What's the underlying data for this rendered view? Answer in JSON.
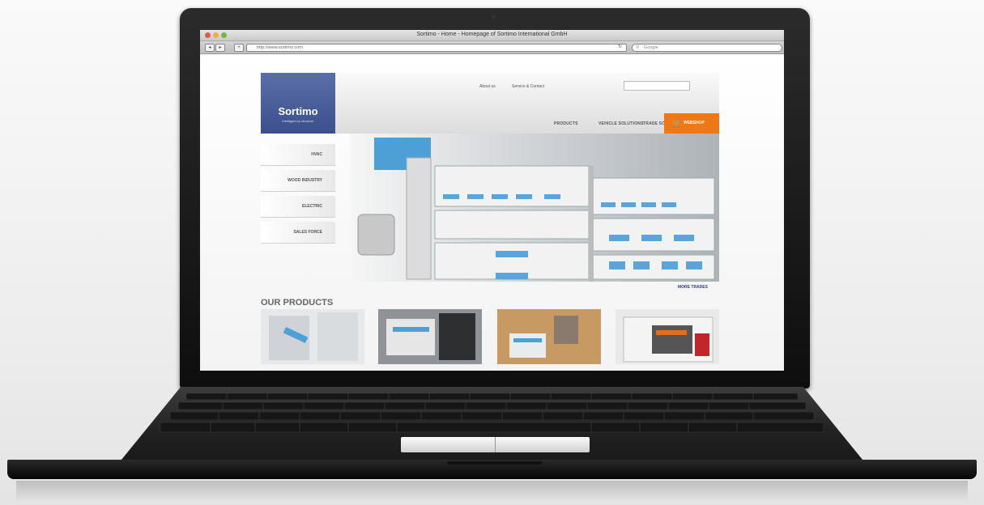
{
  "browser": {
    "title": "Sortimo - Home - Homepage of Sortimo International GmbH",
    "url": "http://www.sortimo.com",
    "search_placeholder": "Google",
    "back_icon": "chevron-left-icon",
    "forward_icon": "chevron-right-icon",
    "add_icon": "plus-icon"
  },
  "site": {
    "logo": {
      "name": "Sortimo",
      "tagline": "intelligent by structure"
    },
    "top_links": [
      "About us",
      "Service & Contact"
    ],
    "nav": [
      "PRODUCTS",
      "VEHICLE SOLUTIONS",
      "TRADE SOLUTIONS"
    ],
    "shop_label": "WEBSHOP",
    "trades": [
      "HVAC",
      "WOOD INDUSTRY",
      "ELECTRIC",
      "SALES FORCE"
    ],
    "more_link": "MORE TRADES",
    "products_heading": "OUR PRODUCTS"
  },
  "colors": {
    "brand_blue": "#4a5f9e",
    "accent_orange": "#f07814",
    "link_blue": "#2a3f8f"
  }
}
